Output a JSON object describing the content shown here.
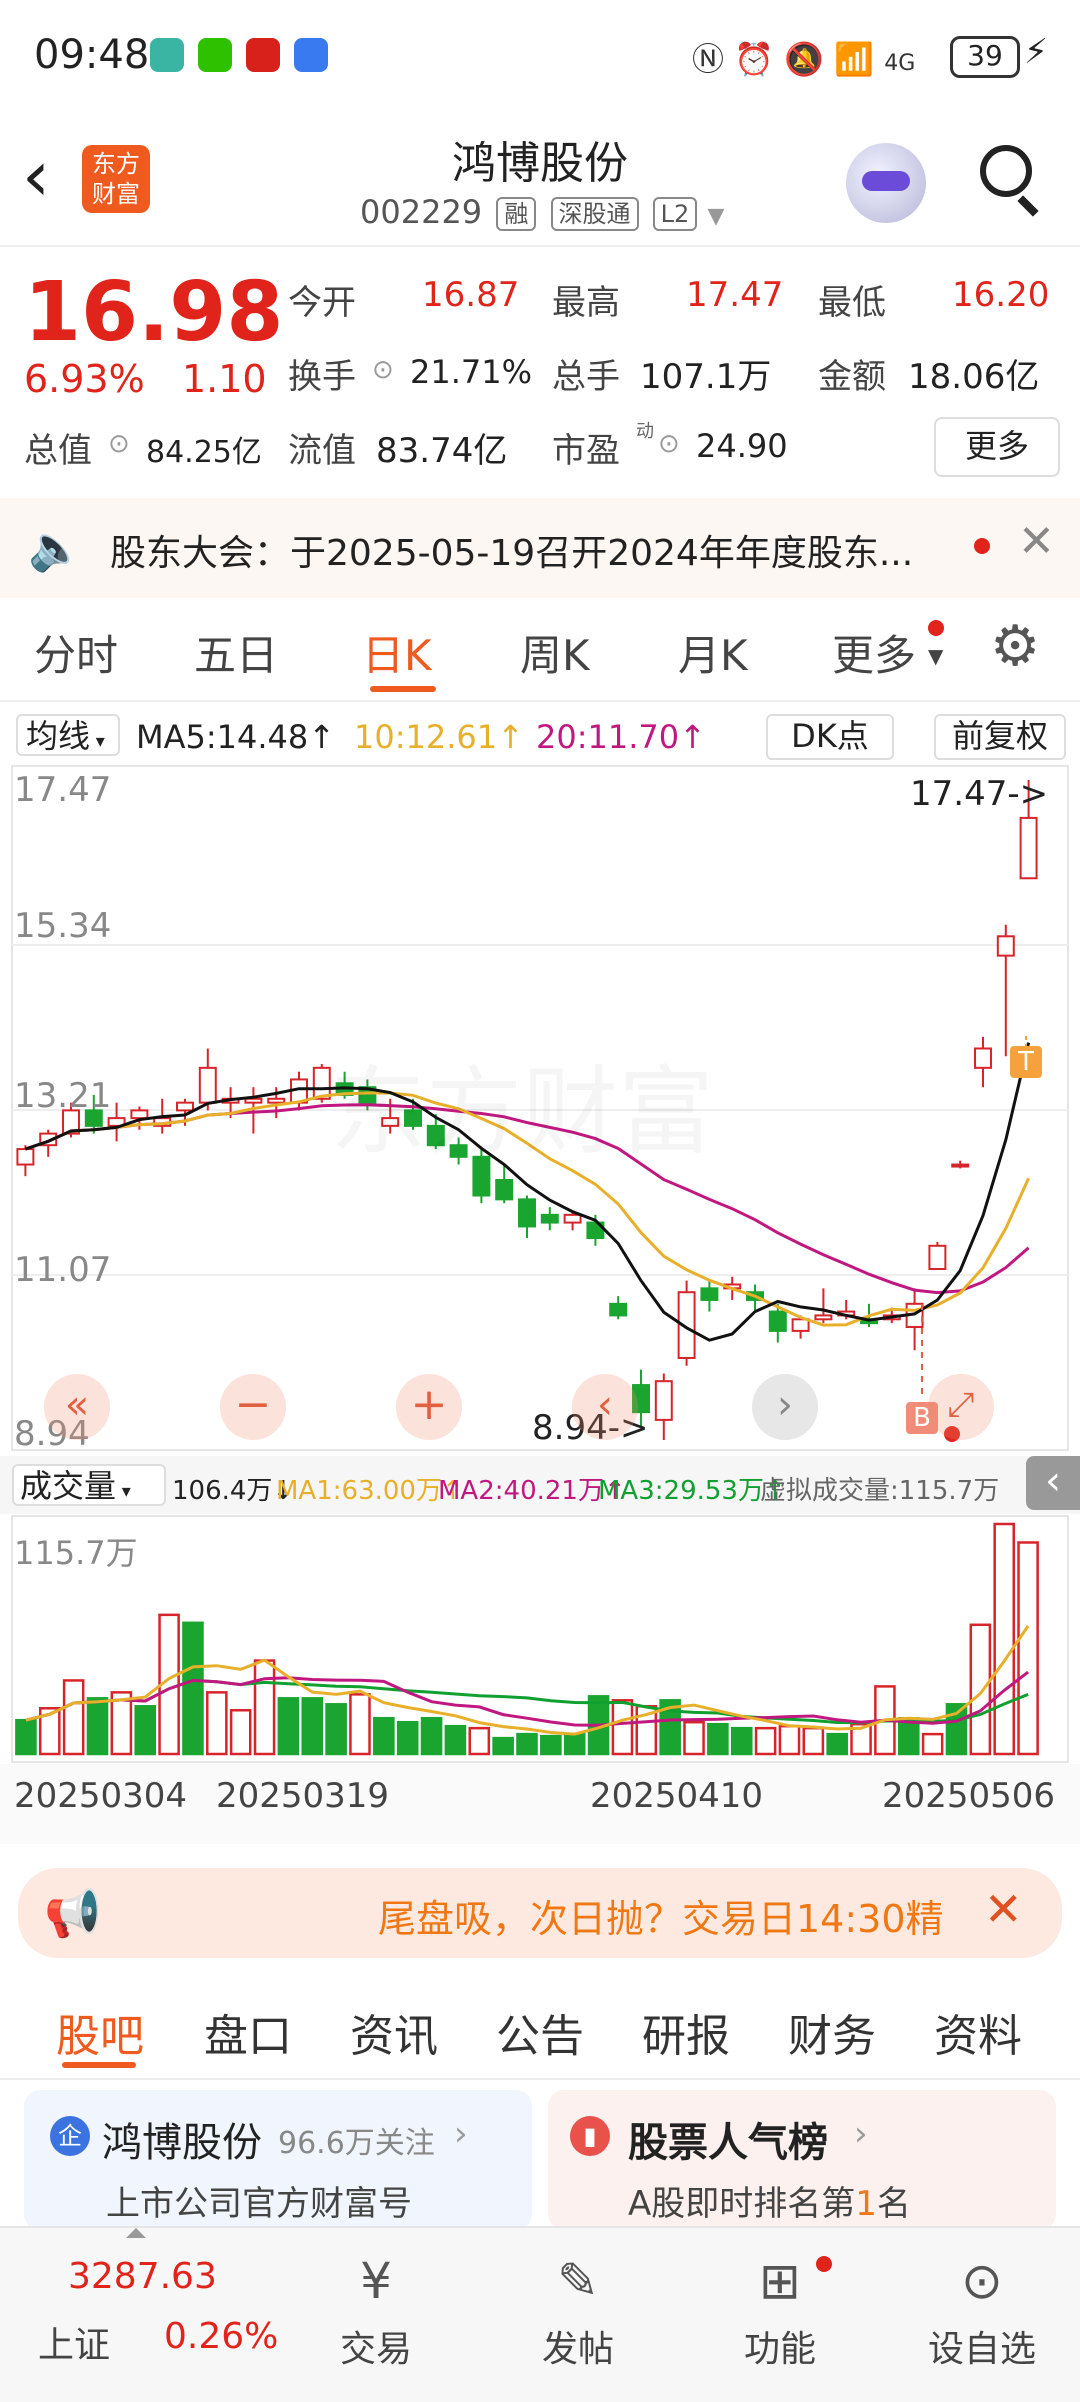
{
  "status": {
    "time": "09:48",
    "battery": "39"
  },
  "header": {
    "logo_text": "东方财富",
    "title": "鸿博股份",
    "code": "002229",
    "tags": [
      "融",
      "深股通",
      "L2"
    ]
  },
  "quote": {
    "price": "16.98",
    "change_pct": "6.93%",
    "change": "1.10",
    "open_label": "今开",
    "open": "16.87",
    "high_label": "最高",
    "high": "17.47",
    "low_label": "最低",
    "low": "16.20",
    "turnover_label": "换手",
    "turnover": "21.71%",
    "volume_label": "总手",
    "volume": "107.1万",
    "amount_label": "金额",
    "amount": "18.06亿",
    "mcap_label": "总值",
    "mcap": "84.25亿",
    "float_label": "流值",
    "float": "83.74亿",
    "pe_label": "市盈",
    "pe_sup": "动",
    "pe": "24.90",
    "more_label": "更多"
  },
  "notice": {
    "text": "股东大会：于2025-05-19召开2024年年度股东..."
  },
  "tabs": [
    "分时",
    "五日",
    "日K",
    "周K",
    "月K",
    "更多"
  ],
  "active_tab": 2,
  "ma": {
    "selector": "均线",
    "ma5": "MA5:14.48↑",
    "ma10": "10:12.61↑",
    "ma20": "20:11.70↑",
    "dk": "DK点",
    "adjust": "前复权"
  },
  "kchart": {
    "y_labels": [
      "17.47",
      "15.34",
      "13.21",
      "11.07",
      "8.94"
    ],
    "high_marker": "17.47->",
    "low_marker": "8.94->",
    "watermark": "东方财富",
    "marker_t": "T",
    "marker_b": "B"
  },
  "vol": {
    "selector": "成交量",
    "current": "106.4万↓",
    "ma1": "MA1:63.00万↑",
    "ma2": "MA2:40.21万↑",
    "ma3": "MA3:29.53万↑",
    "virtual": "虚拟成交量:115.7万",
    "max_label": "115.7万"
  },
  "dates": [
    "20250304",
    "20250319",
    "20250410",
    "20250506"
  ],
  "chart_data": {
    "type": "candlestick",
    "y_range": [
      8.94,
      17.47
    ],
    "candles": [
      {
        "o": 12.5,
        "h": 12.75,
        "l": 12.35,
        "c": 12.7
      },
      {
        "o": 12.75,
        "h": 12.95,
        "l": 12.6,
        "c": 12.9
      },
      {
        "o": 12.9,
        "h": 13.3,
        "l": 12.85,
        "c": 13.2
      },
      {
        "o": 13.2,
        "h": 13.4,
        "l": 12.9,
        "c": 13.0
      },
      {
        "o": 13.0,
        "h": 13.3,
        "l": 12.8,
        "c": 13.1
      },
      {
        "o": 13.1,
        "h": 13.25,
        "l": 12.95,
        "c": 13.2
      },
      {
        "o": 13.0,
        "h": 13.35,
        "l": 12.9,
        "c": 13.1
      },
      {
        "o": 13.2,
        "h": 13.35,
        "l": 13.0,
        "c": 13.3
      },
      {
        "o": 13.3,
        "h": 14.0,
        "l": 13.2,
        "c": 13.75
      },
      {
        "o": 13.3,
        "h": 13.5,
        "l": 13.1,
        "c": 13.35
      },
      {
        "o": 13.3,
        "h": 13.5,
        "l": 12.9,
        "c": 13.35
      },
      {
        "o": 13.3,
        "h": 13.5,
        "l": 13.1,
        "c": 13.35
      },
      {
        "o": 13.3,
        "h": 13.7,
        "l": 13.2,
        "c": 13.6
      },
      {
        "o": 13.35,
        "h": 13.8,
        "l": 13.3,
        "c": 13.75
      },
      {
        "o": 13.55,
        "h": 13.7,
        "l": 13.35,
        "c": 13.4
      },
      {
        "o": 13.5,
        "h": 13.6,
        "l": 13.2,
        "c": 13.3
      },
      {
        "o": 13.0,
        "h": 13.35,
        "l": 12.9,
        "c": 13.1
      },
      {
        "o": 13.2,
        "h": 13.35,
        "l": 12.95,
        "c": 13.0
      },
      {
        "o": 13.0,
        "h": 13.15,
        "l": 12.7,
        "c": 12.75
      },
      {
        "o": 12.75,
        "h": 12.85,
        "l": 12.5,
        "c": 12.6
      },
      {
        "o": 12.6,
        "h": 12.7,
        "l": 12.0,
        "c": 12.1
      },
      {
        "o": 12.3,
        "h": 12.5,
        "l": 12.0,
        "c": 12.05
      },
      {
        "o": 12.05,
        "h": 12.1,
        "l": 11.55,
        "c": 11.7
      },
      {
        "o": 11.85,
        "h": 11.95,
        "l": 11.65,
        "c": 11.75
      },
      {
        "o": 11.75,
        "h": 11.9,
        "l": 11.65,
        "c": 11.85
      },
      {
        "o": 11.75,
        "h": 11.85,
        "l": 11.45,
        "c": 11.55
      },
      {
        "o": 10.7,
        "h": 10.8,
        "l": 10.5,
        "c": 10.55
      },
      {
        "o": 9.65,
        "h": 9.85,
        "l": 9.1,
        "c": 9.3
      },
      {
        "o": 9.2,
        "h": 9.8,
        "l": 8.94,
        "c": 9.7
      },
      {
        "o": 10.0,
        "h": 11.0,
        "l": 9.9,
        "c": 10.85
      },
      {
        "o": 10.9,
        "h": 11.0,
        "l": 10.6,
        "c": 10.75
      },
      {
        "o": 10.9,
        "h": 11.05,
        "l": 10.75,
        "c": 10.95
      },
      {
        "o": 10.85,
        "h": 10.95,
        "l": 10.6,
        "c": 10.75
      },
      {
        "o": 10.6,
        "h": 10.7,
        "l": 10.2,
        "c": 10.35
      },
      {
        "o": 10.35,
        "h": 10.55,
        "l": 10.25,
        "c": 10.5
      },
      {
        "o": 10.5,
        "h": 10.9,
        "l": 10.45,
        "c": 10.55
      },
      {
        "o": 10.55,
        "h": 10.75,
        "l": 10.5,
        "c": 10.6
      },
      {
        "o": 10.5,
        "h": 10.7,
        "l": 10.4,
        "c": 10.45
      },
      {
        "o": 10.5,
        "h": 10.65,
        "l": 10.45,
        "c": 10.55
      },
      {
        "o": 10.4,
        "h": 10.9,
        "l": 10.1,
        "c": 10.7
      },
      {
        "o": 11.15,
        "h": 11.5,
        "l": 11.15,
        "c": 11.45
      },
      {
        "o": 12.5,
        "h": 12.55,
        "l": 12.45,
        "c": 12.5
      },
      {
        "o": 13.75,
        "h": 14.15,
        "l": 13.5,
        "c": 14.0
      },
      {
        "o": 15.2,
        "h": 15.6,
        "l": 13.9,
        "c": 15.45
      },
      {
        "o": 16.2,
        "h": 17.47,
        "l": 16.2,
        "c": 16.98
      }
    ],
    "volume_max": 115.7,
    "volumes": [
      {
        "v": 17,
        "up": false
      },
      {
        "v": 23,
        "up": true
      },
      {
        "v": 37,
        "up": true
      },
      {
        "v": 28,
        "up": false
      },
      {
        "v": 31,
        "up": true
      },
      {
        "v": 24,
        "up": false
      },
      {
        "v": 70,
        "up": true
      },
      {
        "v": 66,
        "up": false
      },
      {
        "v": 31,
        "up": true
      },
      {
        "v": 22,
        "up": true
      },
      {
        "v": 47,
        "up": true
      },
      {
        "v": 28,
        "up": false
      },
      {
        "v": 28,
        "up": false
      },
      {
        "v": 25,
        "up": false
      },
      {
        "v": 30,
        "up": true
      },
      {
        "v": 18,
        "up": false
      },
      {
        "v": 16,
        "up": false
      },
      {
        "v": 18,
        "up": false
      },
      {
        "v": 14,
        "up": false
      },
      {
        "v": 13,
        "up": true
      },
      {
        "v": 8,
        "up": false
      },
      {
        "v": 10,
        "up": false
      },
      {
        "v": 9,
        "up": false
      },
      {
        "v": 10,
        "up": false
      },
      {
        "v": 29,
        "up": false
      },
      {
        "v": 27,
        "up": true
      },
      {
        "v": 24,
        "up": true
      },
      {
        "v": 27,
        "up": false
      },
      {
        "v": 16,
        "up": true
      },
      {
        "v": 15,
        "up": false
      },
      {
        "v": 13,
        "up": false
      },
      {
        "v": 13,
        "up": true
      },
      {
        "v": 14,
        "up": true
      },
      {
        "v": 13,
        "up": true
      },
      {
        "v": 10,
        "up": false
      },
      {
        "v": 15,
        "up": true
      },
      {
        "v": 34,
        "up": true
      },
      {
        "v": 18,
        "up": false
      },
      {
        "v": 10,
        "up": true
      },
      {
        "v": 25,
        "up": false
      },
      {
        "v": 65,
        "up": true
      },
      {
        "v": 115.7,
        "up": true
      },
      {
        "v": 106.4,
        "up": true
      }
    ]
  },
  "banner": {
    "text": "尾盘吸，次日抛？交易日14:30精"
  },
  "bottom_tabs": [
    "股吧",
    "盘口",
    "资讯",
    "公告",
    "研报",
    "财务",
    "资料"
  ],
  "cards": {
    "left_title": "鸿博股份",
    "left_follow": "96.6万关注",
    "left_sub": "上市公司官方财富号",
    "right_title": "股票人气榜",
    "right_sub_a": "A股即时排名第",
    "right_rank": "1",
    "right_sub_b": "名"
  },
  "bottom_nav": {
    "index_value": "3287.63",
    "index_name": "上证",
    "index_change": "0.26%",
    "items": [
      "交易",
      "发帖",
      "功能",
      "设自选"
    ]
  }
}
